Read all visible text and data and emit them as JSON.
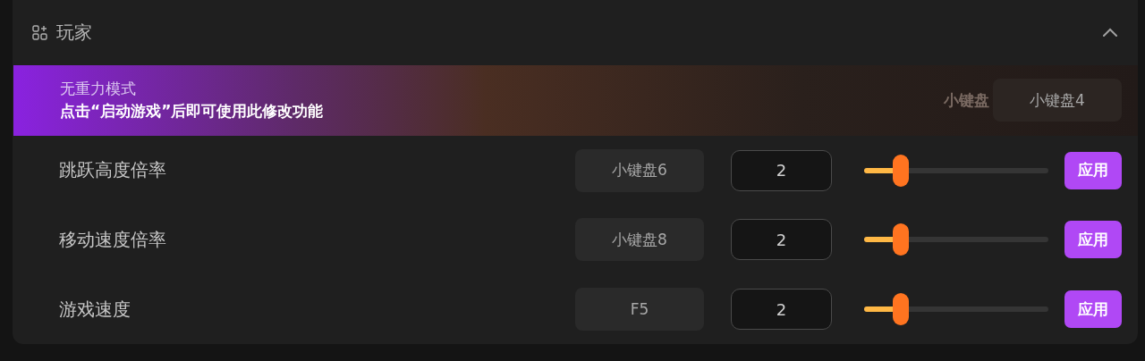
{
  "section": {
    "title": "玩家",
    "expanded": true
  },
  "banner": {
    "title": "无重力模式",
    "hint": "点击“启动游戏”后即可使用此修改功能",
    "ghost_hotkey": "小键盘",
    "hotkey": "小键盘4"
  },
  "rows": [
    {
      "label": "跳跃高度倍率",
      "hotkey": "小键盘6",
      "value": "2",
      "level": 0.2,
      "button": "应用"
    },
    {
      "label": "移动速度倍率",
      "hotkey": "小键盘8",
      "value": "2",
      "level": 0.2,
      "button": "应用"
    },
    {
      "label": "游戏速度",
      "hotkey": "F5",
      "value": "2",
      "level": 0.2,
      "button": "应用"
    }
  ]
}
